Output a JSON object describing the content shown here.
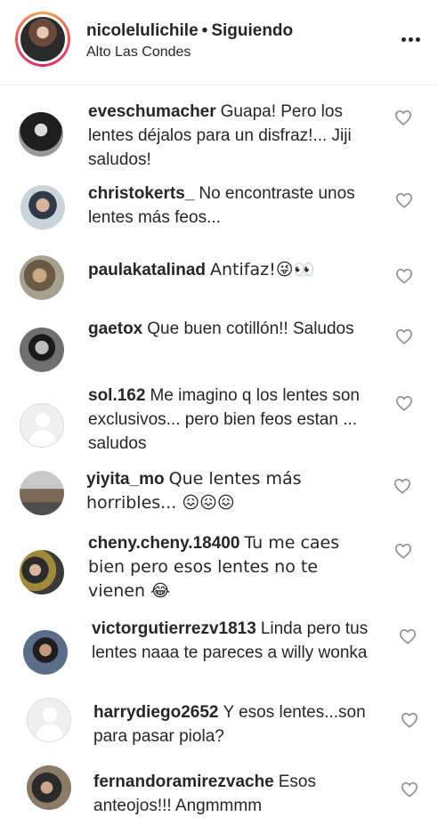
{
  "header": {
    "username": "nicolelulichile",
    "separator": "•",
    "follow_status": "Siguiendo",
    "location": "Alto Las Condes"
  },
  "comments": [
    {
      "username": "eveschumacher",
      "text": "Guapa! Pero los lentes déjalos para un disfraz!... Jiji saludos!"
    },
    {
      "username": "christokerts_",
      "text": "No encontraste unos lentes más feos..."
    },
    {
      "username": "paulakatalinad",
      "text": "Antifaz!😜👀"
    },
    {
      "username": "gaetox",
      "text": "Que buen cotillón!! Saludos"
    },
    {
      "username": "sol.162",
      "text": "Me imagino q los lentes son exclusivos... pero bien feos estan ... saludos"
    },
    {
      "username": "yiyita_mo",
      "text": "Que lentes más horribles... 😖😖😖"
    },
    {
      "username": "cheny.cheny.18400",
      "text": "Tu me caes bien pero esos lentes no te vienen 😂"
    },
    {
      "username": "victorgutierrezv1813",
      "text": "Linda pero tus lentes naaa te pareces a willy wonka"
    },
    {
      "username": "harrydiego2652",
      "text": "Y esos lentes...son para pasar piola?"
    },
    {
      "username": "fernandoramirezvache",
      "text": "Esos anteojos!!! Angmmmm"
    }
  ],
  "icons": {
    "more": "more-horizontal-icon",
    "like": "heart-outline-icon"
  },
  "colors": {
    "text": "#262626",
    "divider": "#efefef",
    "story_ring": [
      "#f9a24a",
      "#f0524e",
      "#d62a7d"
    ]
  }
}
